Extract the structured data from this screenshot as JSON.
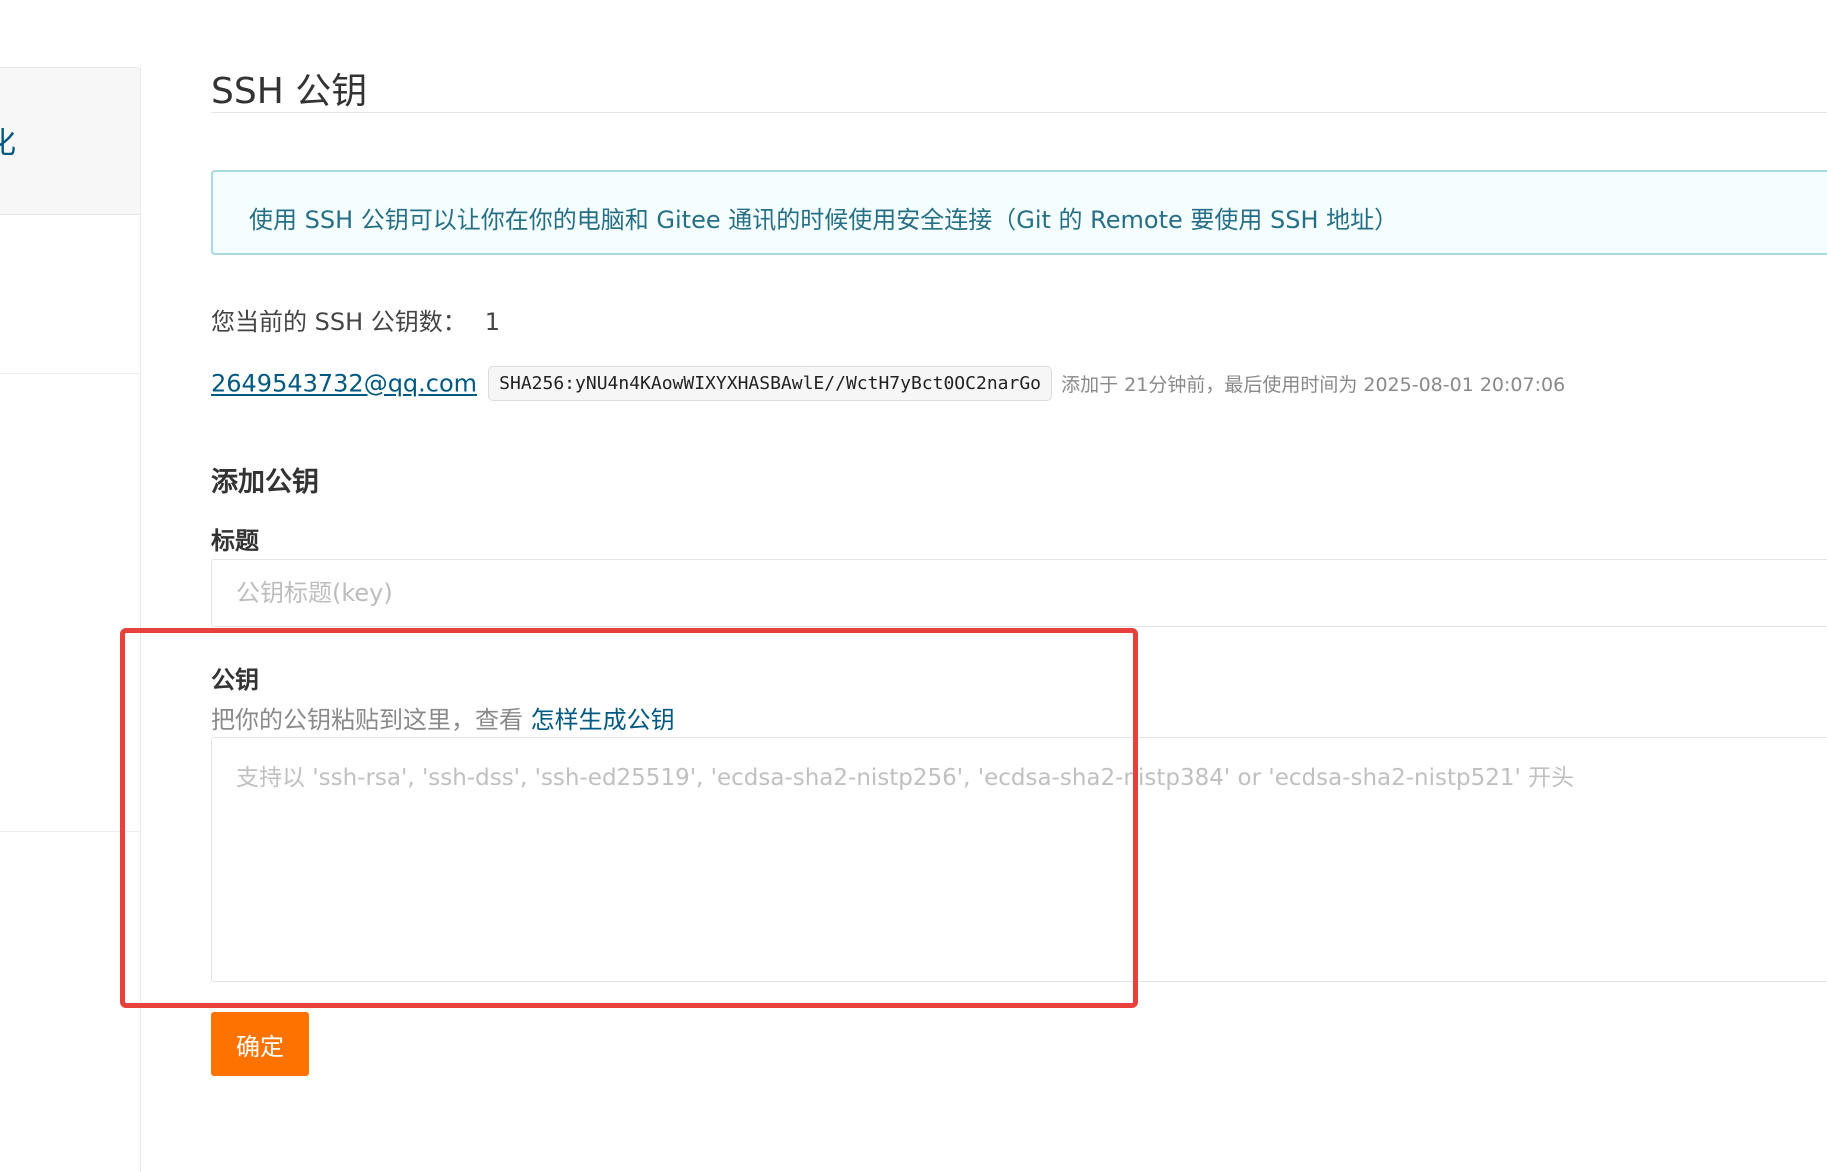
{
  "sidebar": {
    "partial_label": "化"
  },
  "header": {
    "title": "SSH 公钥"
  },
  "notice": "使用 SSH 公钥可以让你在你的电脑和 Gitee 通讯的时候使用安全连接（Git 的 Remote 要使用 SSH 地址）",
  "key_count": {
    "label": "您当前的 SSH 公钥数：",
    "value": "1"
  },
  "keys": [
    {
      "title": "2649543732@qq.com",
      "fingerprint": "SHA256:yNU4n4KAowWIXYXHASBAwlE//WctH7yBct0OC2narGo",
      "meta": "添加于 21分钟前，最后使用时间为 2025-08-01 20:07:06"
    }
  ],
  "add_form": {
    "section_title": "添加公钥",
    "title_label": "标题",
    "title_placeholder": "公钥标题(key)",
    "title_value": "",
    "pubkey_label": "公钥",
    "pubkey_hint": "把你的公钥粘贴到这里，查看 ",
    "pubkey_hint_link": "怎样生成公钥",
    "pubkey_placeholder": "支持以 'ssh-rsa', 'ssh-dss', 'ssh-ed25519', 'ecdsa-sha2-nistp256', 'ecdsa-sha2-nistp384' or 'ecdsa-sha2-nistp521' 开头",
    "pubkey_value": "",
    "submit_label": "确定"
  },
  "colors": {
    "accent_orange": "#fe7300",
    "link_blue": "#005980",
    "highlight_red": "#e8413b",
    "notice_bg": "#f5fefe"
  }
}
